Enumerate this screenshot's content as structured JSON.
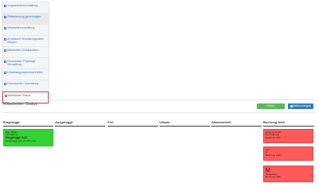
{
  "sidebar": {
    "items": [
      {
        "label": "Vorgesetztenverwaltung",
        "state": "normal"
      },
      {
        "label": "Zeiterfassung genehmigen",
        "state": "hover"
      },
      {
        "label": "Mitarbeiterverwaltung",
        "state": "normal"
      },
      {
        "label": "Arbeitszeit Verwaltungsdaten pflegen",
        "state": "normal"
      },
      {
        "label": "Mitarbeiter Urlaubsdaten",
        "state": "normal"
      },
      {
        "label": "Gemeinsam Feiertage Verwaltung",
        "state": "normal"
      },
      {
        "label": "Urlaubstagesabwesenheiten",
        "state": "normal"
      },
      {
        "label": "Überstunden Verwaltung",
        "state": "normal"
      },
      {
        "label": "Mitarbeiter Status",
        "state": "active"
      }
    ]
  },
  "main": {
    "title": "Mitarbeiter Status",
    "buttons": {
      "refresh": "Fehlen aktualisieren",
      "add": "Zeitbuchungen"
    },
    "columns": [
      "Eingeloggt",
      "Ausgeloggt",
      "Frei",
      "Urlaub",
      "Abwesenheit",
      "Buchung fehlt"
    ],
    "cards": {
      "logged_in": {
        "name": "Max Müller",
        "dept": "Verwaltung",
        "status": "Eingeloggt: 8:41",
        "since": "Eingeloggt seit: 2h 33m 43s"
      },
      "missing": [
        {
          "name": "Anna Schmidt",
          "dept": "Buchhaltung",
          "note": "Buchung fehlt"
        },
        {
          "name": "Jan",
          "dept": "IT",
          "note": "Buchung fehlt"
        },
        {
          "name": "M",
          "dept": "Produktion",
          "note": "Buchung fehlt"
        }
      ]
    }
  },
  "colors": {
    "link": "#3a76c4",
    "active_border": "#d9534f",
    "green_card": "#35d235",
    "red_card": "#ff5a5a",
    "btn_green": "#5cb85c",
    "btn_blue": "#337ab7"
  }
}
